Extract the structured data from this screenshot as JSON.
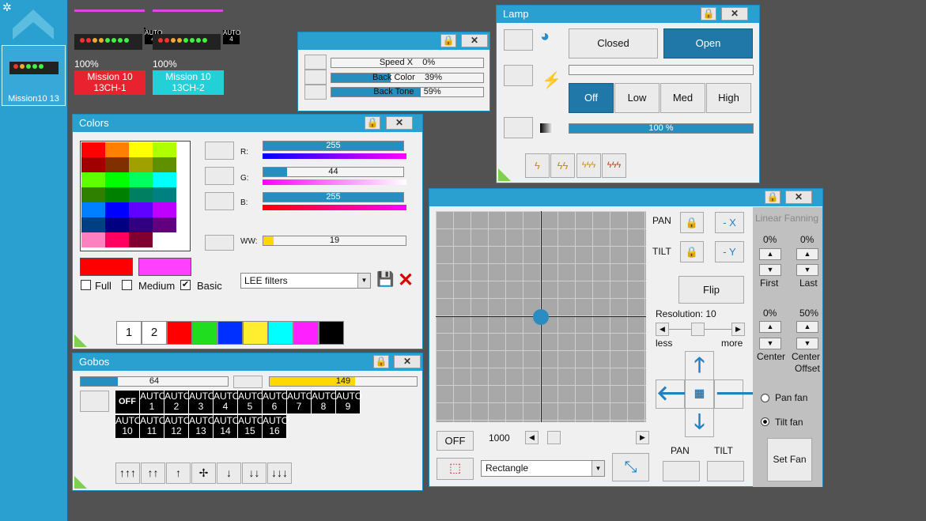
{
  "sidebar": {
    "fixture_label": "Mission10 13"
  },
  "devices": [
    {
      "pct": "100%",
      "name_l1": "Mission 10",
      "name_l2": "13CH-1",
      "color": "#e8222e",
      "badge": "AUTO\n4"
    },
    {
      "pct": "100%",
      "name_l1": "Mission 10",
      "name_l2": "13CH-2",
      "color": "#22d0d8",
      "badge": "AUTO\n4"
    }
  ],
  "speed": {
    "rows": [
      {
        "label": "Speed X",
        "value": "0%",
        "fill": 0
      },
      {
        "label": "Back Color",
        "value": "39%",
        "fill": 39
      },
      {
        "label": "Back Tone",
        "value": "59%",
        "fill": 59
      }
    ]
  },
  "lamp": {
    "title": "Lamp",
    "closed": "Closed",
    "open": "Open",
    "levels": [
      "Off",
      "Low",
      "Med",
      "High"
    ],
    "dimmer": "100 %"
  },
  "colors": {
    "title": "Colors",
    "r_label": "R:",
    "g_label": "G:",
    "b_label": "B:",
    "ww_label": "WW:",
    "r": "255",
    "g": "44",
    "b": "255",
    "ww": "19",
    "full": "Full",
    "medium": "Medium",
    "basic": "Basic",
    "filter": "LEE filters",
    "swatch_nums": [
      "1",
      "2"
    ],
    "palette": [
      "#ff0000",
      "#ff8000",
      "#ffff00",
      "#b0ff00",
      "#a00000",
      "#803000",
      "#a0a000",
      "#609000",
      "#60ff00",
      "#00ff00",
      "#00ff60",
      "#00ffff",
      "#308000",
      "#008000",
      "#008060",
      "#008080",
      "#0080ff",
      "#0000ff",
      "#6000ff",
      "#c000ff",
      "#004080",
      "#000080",
      "#300080",
      "#600080",
      "#ff80c0",
      "#ff0060",
      "#800030",
      "#ffffff"
    ],
    "swatches": [
      "#ff0000",
      "#20dd20",
      "#0030ff",
      "#ffee30",
      "#00ffff",
      "#ff20ff",
      "#000000"
    ]
  },
  "gobos": {
    "title": "Gobos",
    "slider1": "64",
    "slider2": "149",
    "off": "OFF",
    "cells": [
      "AUTO 1",
      "AUTO 2",
      "AUTO 3",
      "AUTO 4",
      "AUTO 5",
      "AUTO 6",
      "AUTO 7",
      "AUTO 8",
      "AUTO 9",
      "AUTO 10",
      "AUTO 11",
      "AUTO 12",
      "AUTO 13",
      "AUTO 14",
      "AUTO 15",
      "AUTO 16"
    ]
  },
  "pantilt": {
    "pan": "PAN",
    "tilt": "TILT",
    "xbtn": "- X",
    "ybtn": "- Y",
    "flip": "Flip",
    "resolution": "Resolution: 10",
    "less": "less",
    "more": "more",
    "off": "OFF",
    "speed": "1000",
    "shape": "Rectangle",
    "pan_lbl": "PAN",
    "tilt_lbl": "TILT"
  },
  "fanning": {
    "title": "Linear Fanning",
    "first_pct": "0%",
    "last_pct": "0%",
    "first": "First",
    "last": "Last",
    "center_pct": "0%",
    "offset_pct": "50%",
    "center": "Center",
    "offset1": "Center",
    "offset2": "Offset",
    "panfan": "Pan fan",
    "tiltfan": "Tilt fan",
    "setfan": "Set Fan"
  }
}
